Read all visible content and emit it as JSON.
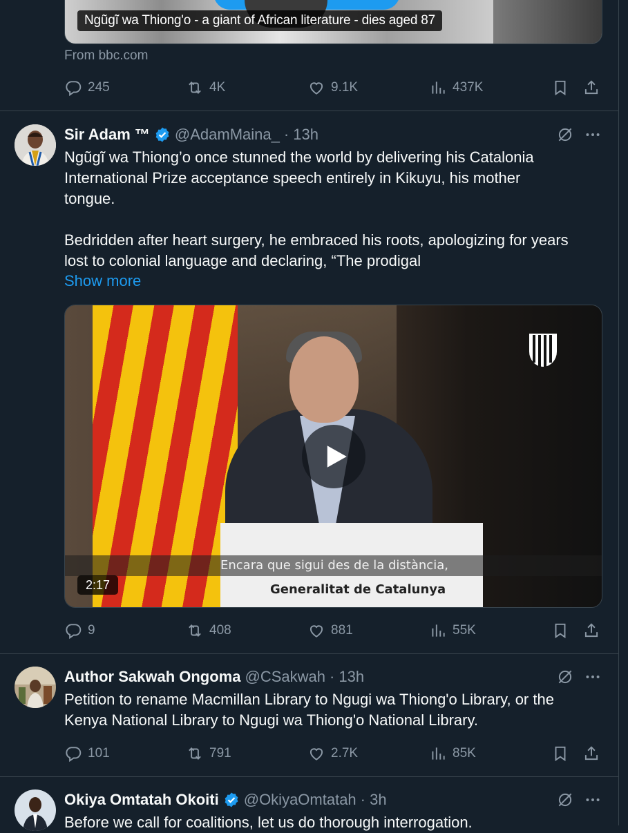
{
  "prev_tweet": {
    "card": {
      "caption": "Ngũgĩ wa Thiong'o - a giant of African literature - dies aged 87",
      "source": "From bbc.com"
    },
    "actions": {
      "replies": "245",
      "retweets": "4K",
      "likes": "9.1K",
      "views": "437K"
    }
  },
  "tweets": [
    {
      "name": "Sir Adam ™",
      "verified": true,
      "handle": "@AdamMaina_",
      "time": "· 13h",
      "text_lines": [
        "Ngũgĩ wa Thiong’o once stunned the world by delivering his Catalonia",
        "International Prize acceptance speech entirely in Kikuyu, his mother",
        "tongue.",
        "",
        "Bedridden after heart surgery, he embraced his roots, apologizing for years",
        "lost to colonial language and declaring, “The prodigal"
      ],
      "show_more": "Show more",
      "video": {
        "subtitle": "Encara que sigui des de la distància,",
        "podium_text": "Generalitat de Catalunya",
        "duration": "2:17"
      },
      "actions": {
        "replies": "9",
        "retweets": "408",
        "likes": "881",
        "views": "55K"
      }
    },
    {
      "name": "Author Sakwah Ongoma",
      "verified": false,
      "handle": "@CSakwah",
      "time": "· 13h",
      "text_lines": [
        "Petition to rename Macmillan Library to Ngugi wa Thiong'o Library, or the",
        "Kenya National Library to Ngugi wa Thiong'o National Library."
      ],
      "actions": {
        "replies": "101",
        "retweets": "791",
        "likes": "2.7K",
        "views": "85K"
      }
    },
    {
      "name": "Okiya Omtatah Okoiti",
      "verified": true,
      "handle": "@OkiyaOmtatah",
      "time": "· 3h",
      "text_lines": [
        "Before we call for coalitions, let us do thorough interrogation."
      ]
    }
  ],
  "colors": {
    "background": "#15202b",
    "text": "#f7f9f9",
    "muted": "#8b98a5",
    "accent": "#1d9bf0",
    "divider": "#38444d"
  }
}
